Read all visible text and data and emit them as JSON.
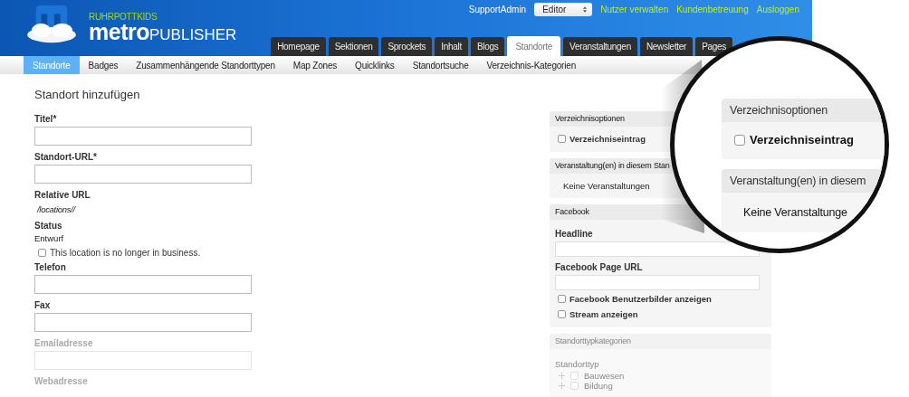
{
  "brand": {
    "tagline": "RUHRPOTTKIDS",
    "name_bold": "metro",
    "name_rest": "PUBLISHER"
  },
  "user_bar": {
    "user": "SupportAdmin",
    "role_select": "Editor",
    "links": [
      "Nutzer verwalten",
      "Kundenbetreuung",
      "Ausloggen"
    ]
  },
  "main_tabs": [
    {
      "label": "Homepage",
      "selected": false
    },
    {
      "label": "Sektionen",
      "selected": false
    },
    {
      "label": "Sprockets",
      "selected": false
    },
    {
      "label": "Inhalt",
      "selected": false
    },
    {
      "label": "Blogs",
      "selected": false
    },
    {
      "label": "Standorte",
      "selected": true
    },
    {
      "label": "Veranstaltungen",
      "selected": false
    },
    {
      "label": "Newsletter",
      "selected": false
    },
    {
      "label": "Pages",
      "selected": false
    }
  ],
  "sub_nav": [
    {
      "label": "Standorte",
      "selected": true
    },
    {
      "label": "Badges",
      "selected": false
    },
    {
      "label": "Zusammenhängende Standorttypen",
      "selected": false
    },
    {
      "label": "Map Zones",
      "selected": false
    },
    {
      "label": "Quicklinks",
      "selected": false
    },
    {
      "label": "Standortsuche",
      "selected": false
    },
    {
      "label": "Verzeichnis-Kategorien",
      "selected": false
    }
  ],
  "form": {
    "title": "Standort hinzufügen",
    "items": [
      {
        "kind": "input",
        "label": "Titel*",
        "dimmed": false
      },
      {
        "kind": "input",
        "label": "Standort-URL*",
        "dimmed": false
      },
      {
        "kind": "text",
        "label": "Relative URL",
        "value": "/locations//",
        "dimmed": false
      },
      {
        "kind": "text",
        "label": "Status",
        "value": "Entwurf",
        "dimmed": false
      },
      {
        "kind": "checkbox",
        "label": "This location is no longer in business.",
        "checked": false,
        "dimmed": false
      },
      {
        "kind": "input",
        "label": "Telefon",
        "dimmed": false
      },
      {
        "kind": "input",
        "label": "Fax",
        "dimmed": false
      },
      {
        "kind": "input",
        "label": "Emailadresse",
        "dimmed": true
      },
      {
        "kind": "label",
        "label": "Webadresse",
        "dimmed": true
      }
    ]
  },
  "sidebar": {
    "panels": [
      {
        "title": "Verzeichnisoptionen",
        "dimmed": false,
        "items": [
          {
            "kind": "checkbox",
            "label": "Verzeichniseintrag",
            "checked": false
          }
        ]
      },
      {
        "title": "Veranstaltung(en) in diesem Stan",
        "dimmed": false,
        "items": [
          {
            "kind": "note",
            "label": "Keine Veranstaltungen"
          }
        ]
      },
      {
        "title": "Facebook",
        "dimmed": false,
        "items": [
          {
            "kind": "input",
            "label": "Headline"
          },
          {
            "kind": "input",
            "label": "Facebook Page URL"
          },
          {
            "kind": "checkbox",
            "label": "Facebook Benutzerbilder anzeigen",
            "checked": false
          },
          {
            "kind": "checkbox",
            "label": "Stream anzeigen",
            "checked": false
          }
        ]
      },
      {
        "title": "Standorttypkategorien",
        "dimmed": true,
        "items": [
          {
            "kind": "heading",
            "label": "Standorttyp"
          },
          {
            "kind": "tree",
            "label": "Bauwesen",
            "checked": false
          },
          {
            "kind": "tree",
            "label": "Bildung",
            "checked": false
          }
        ]
      }
    ]
  },
  "magnifier": {
    "panels": [
      {
        "title": "Verzeichnisoptionen",
        "items": [
          {
            "kind": "checkbox",
            "label": "Verzeichniseintrag",
            "checked": false
          }
        ]
      },
      {
        "title": "Veranstaltung(en) in diesem",
        "items": [
          {
            "kind": "note",
            "label": "Keine Veranstaltunge"
          }
        ]
      }
    ]
  }
}
